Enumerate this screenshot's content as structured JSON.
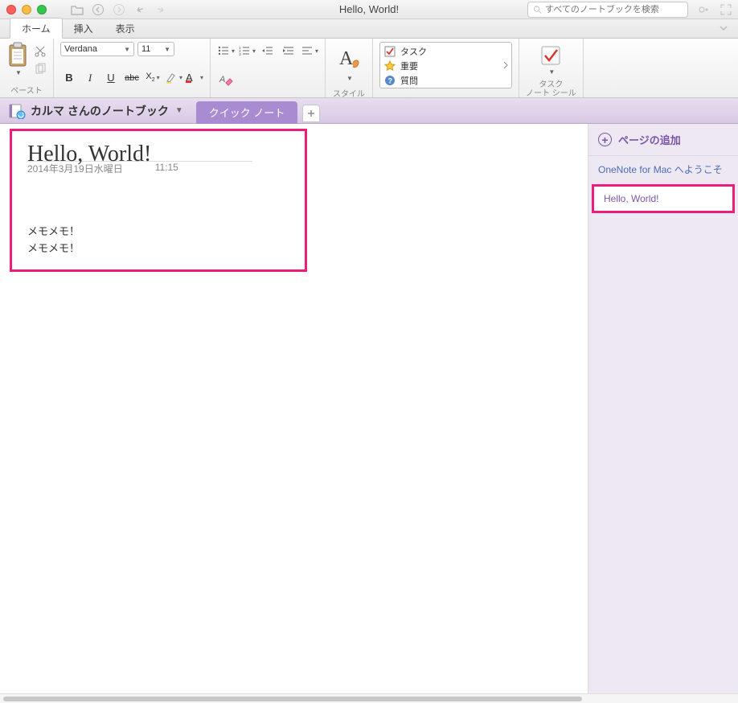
{
  "window": {
    "title": "Hello, World!",
    "search_placeholder": "すべてのノートブックを検索"
  },
  "ribbon_tabs": {
    "home": "ホーム",
    "insert": "挿入",
    "view": "表示"
  },
  "ribbon": {
    "paste_label": "ペースト",
    "font_name": "Verdana",
    "font_size": "11",
    "style_label": "スタイル",
    "tags": {
      "task": "タスク",
      "important": "重要",
      "question": "質問"
    },
    "tasknote_label_1": "タスク",
    "tasknote_label_2": "ノート シール"
  },
  "notebook": {
    "name": "カルマ さんのノートブック",
    "section_tab": "クイック ノート"
  },
  "page": {
    "title": "Hello, World!",
    "date": "2014年3月19日水曜日",
    "time": "11:15",
    "body_line_1": "メモメモ！",
    "body_line_2": "メモメモ！"
  },
  "side": {
    "add_page": "ページの追加",
    "item_welcome": "OneNote for Mac へようこそ",
    "item_current": "Hello, World!"
  }
}
